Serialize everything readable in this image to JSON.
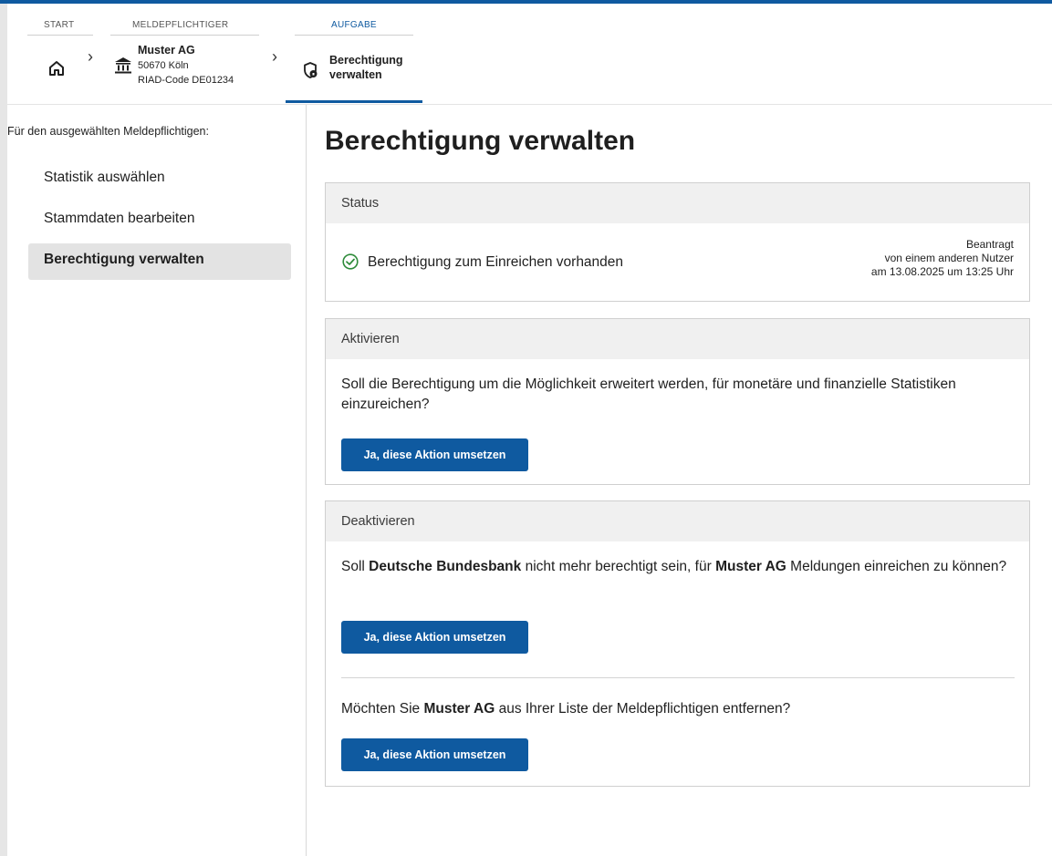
{
  "breadcrumb": {
    "start_label": "START",
    "entity_label": "MELDEPFLICHTIGER",
    "task_label": "AUFGABE",
    "entity": {
      "name": "Muster AG",
      "city": "50670 Köln",
      "riad": "RIAD-Code DE01234"
    },
    "task_name": "Berechtigung verwalten"
  },
  "sidebar": {
    "title": "Für den ausgewählten Meldepflichtigen:",
    "items": [
      {
        "label": "Statistik auswählen",
        "active": false
      },
      {
        "label": "Stammdaten bearbeiten",
        "active": false
      },
      {
        "label": "Berechtigung verwalten",
        "active": true
      }
    ]
  },
  "main": {
    "title": "Berechtigung verwalten",
    "status": {
      "header": "Status",
      "text": "Berechtigung zum Einreichen vorhanden",
      "meta_line1": "Beantragt",
      "meta_line2": "von einem anderen Nutzer",
      "meta_line3": "am 13.08.2025 um 13:25 Uhr"
    },
    "activate": {
      "header": "Aktivieren",
      "question": "Soll die Berechtigung um die Möglichkeit erweitert werden, für monetäre und finanzielle Statistiken einzureichen?",
      "button": "Ja, diese Aktion umsetzen"
    },
    "deactivate": {
      "header": "Deaktivieren",
      "q1_prefix": "Soll ",
      "q1_bold1": "Deutsche Bundesbank",
      "q1_middle": " nicht mehr berechtigt sein, für ",
      "q1_bold2": "Muster AG",
      "q1_suffix": " Meldungen einreichen zu können?",
      "button1": "Ja, diese Aktion umsetzen",
      "q2_prefix": "Möchten Sie ",
      "q2_bold": "Muster AG",
      "q2_suffix": " aus Ihrer Liste der Meldepflichtigen entfernen?",
      "button2": "Ja, diese Aktion umsetzen"
    }
  },
  "colors": {
    "accent": "#0f5aa0",
    "success": "#2e8b3a",
    "panel_header": "#f0f0f0",
    "active_nav": "#e3e3e3"
  }
}
